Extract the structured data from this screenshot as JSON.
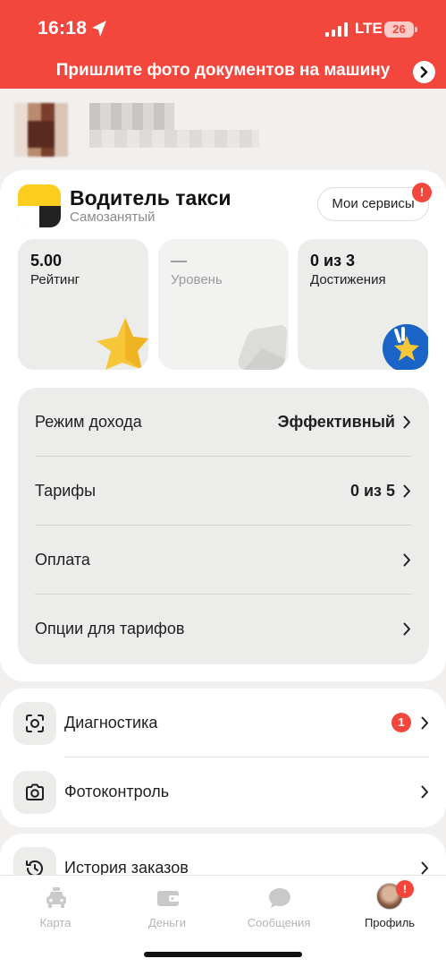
{
  "status_bar": {
    "time": "16:18",
    "network": "LTE",
    "battery": "26"
  },
  "banner": {
    "text": "Пришлите фото документов на машину"
  },
  "brand": {
    "title": "Водитель такси",
    "subtitle": "Самозанятый",
    "services_button": "Мои сервисы",
    "services_badge": "!"
  },
  "stats": [
    {
      "value": "5.00",
      "label": "Рейтинг"
    },
    {
      "value": "—",
      "label": "Уровень"
    },
    {
      "value": "0 из 3",
      "label": "Достижения"
    }
  ],
  "settings": [
    {
      "label": "Режим дохода",
      "value": "Эффективный"
    },
    {
      "label": "Тарифы",
      "value": "0 из 5"
    },
    {
      "label": "Оплата",
      "value": ""
    },
    {
      "label": "Опции для тарифов",
      "value": ""
    }
  ],
  "list": [
    {
      "label": "Диагностика",
      "icon": "scan-icon",
      "badge": "1"
    },
    {
      "label": "Фотоконтроль",
      "icon": "camera-icon"
    },
    {
      "label": "История заказов",
      "icon": "history-icon"
    }
  ],
  "tabs": [
    {
      "label": "Карта",
      "icon": "car-icon"
    },
    {
      "label": "Деньги",
      "icon": "wallet-icon"
    },
    {
      "label": "Сообщения",
      "icon": "chat-icon"
    },
    {
      "label": "Профиль",
      "icon": "profile-avatar",
      "badge": "!"
    }
  ],
  "colors": {
    "accent_red": "#f3463c",
    "brand_yellow": "#fccc1e",
    "inactive_tab": "#b5b5b5"
  }
}
